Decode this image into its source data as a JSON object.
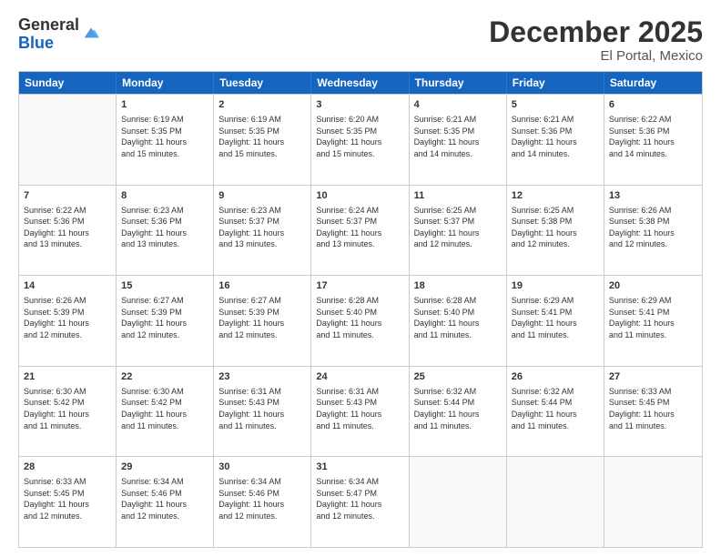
{
  "logo": {
    "general": "General",
    "blue": "Blue"
  },
  "title": "December 2025",
  "location": "El Portal, Mexico",
  "days": [
    "Sunday",
    "Monday",
    "Tuesday",
    "Wednesday",
    "Thursday",
    "Friday",
    "Saturday"
  ],
  "weeks": [
    [
      {
        "day": "",
        "content": ""
      },
      {
        "day": "1",
        "content": "Sunrise: 6:19 AM\nSunset: 5:35 PM\nDaylight: 11 hours\nand 15 minutes."
      },
      {
        "day": "2",
        "content": "Sunrise: 6:19 AM\nSunset: 5:35 PM\nDaylight: 11 hours\nand 15 minutes."
      },
      {
        "day": "3",
        "content": "Sunrise: 6:20 AM\nSunset: 5:35 PM\nDaylight: 11 hours\nand 15 minutes."
      },
      {
        "day": "4",
        "content": "Sunrise: 6:21 AM\nSunset: 5:35 PM\nDaylight: 11 hours\nand 14 minutes."
      },
      {
        "day": "5",
        "content": "Sunrise: 6:21 AM\nSunset: 5:36 PM\nDaylight: 11 hours\nand 14 minutes."
      },
      {
        "day": "6",
        "content": "Sunrise: 6:22 AM\nSunset: 5:36 PM\nDaylight: 11 hours\nand 14 minutes."
      }
    ],
    [
      {
        "day": "7",
        "content": "Sunrise: 6:22 AM\nSunset: 5:36 PM\nDaylight: 11 hours\nand 13 minutes."
      },
      {
        "day": "8",
        "content": "Sunrise: 6:23 AM\nSunset: 5:36 PM\nDaylight: 11 hours\nand 13 minutes."
      },
      {
        "day": "9",
        "content": "Sunrise: 6:23 AM\nSunset: 5:37 PM\nDaylight: 11 hours\nand 13 minutes."
      },
      {
        "day": "10",
        "content": "Sunrise: 6:24 AM\nSunset: 5:37 PM\nDaylight: 11 hours\nand 13 minutes."
      },
      {
        "day": "11",
        "content": "Sunrise: 6:25 AM\nSunset: 5:37 PM\nDaylight: 11 hours\nand 12 minutes."
      },
      {
        "day": "12",
        "content": "Sunrise: 6:25 AM\nSunset: 5:38 PM\nDaylight: 11 hours\nand 12 minutes."
      },
      {
        "day": "13",
        "content": "Sunrise: 6:26 AM\nSunset: 5:38 PM\nDaylight: 11 hours\nand 12 minutes."
      }
    ],
    [
      {
        "day": "14",
        "content": "Sunrise: 6:26 AM\nSunset: 5:39 PM\nDaylight: 11 hours\nand 12 minutes."
      },
      {
        "day": "15",
        "content": "Sunrise: 6:27 AM\nSunset: 5:39 PM\nDaylight: 11 hours\nand 12 minutes."
      },
      {
        "day": "16",
        "content": "Sunrise: 6:27 AM\nSunset: 5:39 PM\nDaylight: 11 hours\nand 12 minutes."
      },
      {
        "day": "17",
        "content": "Sunrise: 6:28 AM\nSunset: 5:40 PM\nDaylight: 11 hours\nand 11 minutes."
      },
      {
        "day": "18",
        "content": "Sunrise: 6:28 AM\nSunset: 5:40 PM\nDaylight: 11 hours\nand 11 minutes."
      },
      {
        "day": "19",
        "content": "Sunrise: 6:29 AM\nSunset: 5:41 PM\nDaylight: 11 hours\nand 11 minutes."
      },
      {
        "day": "20",
        "content": "Sunrise: 6:29 AM\nSunset: 5:41 PM\nDaylight: 11 hours\nand 11 minutes."
      }
    ],
    [
      {
        "day": "21",
        "content": "Sunrise: 6:30 AM\nSunset: 5:42 PM\nDaylight: 11 hours\nand 11 minutes."
      },
      {
        "day": "22",
        "content": "Sunrise: 6:30 AM\nSunset: 5:42 PM\nDaylight: 11 hours\nand 11 minutes."
      },
      {
        "day": "23",
        "content": "Sunrise: 6:31 AM\nSunset: 5:43 PM\nDaylight: 11 hours\nand 11 minutes."
      },
      {
        "day": "24",
        "content": "Sunrise: 6:31 AM\nSunset: 5:43 PM\nDaylight: 11 hours\nand 11 minutes."
      },
      {
        "day": "25",
        "content": "Sunrise: 6:32 AM\nSunset: 5:44 PM\nDaylight: 11 hours\nand 11 minutes."
      },
      {
        "day": "26",
        "content": "Sunrise: 6:32 AM\nSunset: 5:44 PM\nDaylight: 11 hours\nand 11 minutes."
      },
      {
        "day": "27",
        "content": "Sunrise: 6:33 AM\nSunset: 5:45 PM\nDaylight: 11 hours\nand 11 minutes."
      }
    ],
    [
      {
        "day": "28",
        "content": "Sunrise: 6:33 AM\nSunset: 5:45 PM\nDaylight: 11 hours\nand 12 minutes."
      },
      {
        "day": "29",
        "content": "Sunrise: 6:34 AM\nSunset: 5:46 PM\nDaylight: 11 hours\nand 12 minutes."
      },
      {
        "day": "30",
        "content": "Sunrise: 6:34 AM\nSunset: 5:46 PM\nDaylight: 11 hours\nand 12 minutes."
      },
      {
        "day": "31",
        "content": "Sunrise: 6:34 AM\nSunset: 5:47 PM\nDaylight: 11 hours\nand 12 minutes."
      },
      {
        "day": "",
        "content": ""
      },
      {
        "day": "",
        "content": ""
      },
      {
        "day": "",
        "content": ""
      }
    ]
  ]
}
